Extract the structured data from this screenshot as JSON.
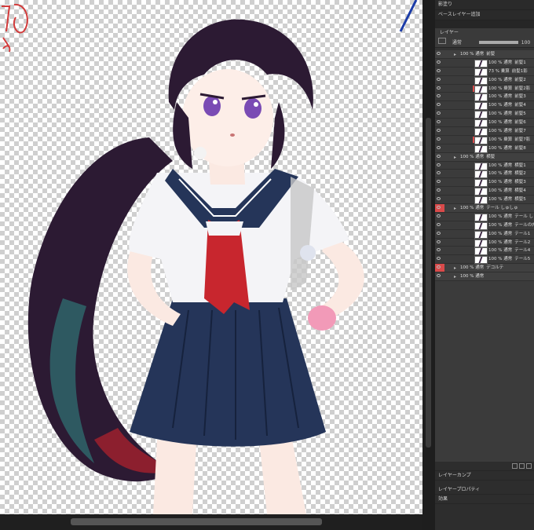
{
  "panel": {
    "top_label": "影塗り",
    "breadcrumb": "ベースレイヤー追加",
    "layer_tab": "レイヤー",
    "blend_mode": "通常",
    "opacity": "100",
    "bottom_tabs": [
      "レイヤーカンプ",
      "レイヤープロパティ"
    ],
    "effect_label": "効果",
    "layers": [
      {
        "kind": "folder",
        "indent": 1,
        "pct": "100 % 通常",
        "name": "前髪",
        "red": false
      },
      {
        "kind": "layer",
        "indent": 2,
        "pct": "100 % 通常",
        "name": "前髪1",
        "red": false
      },
      {
        "kind": "layer",
        "indent": 2,
        "pct": "73 % 乗算",
        "name": "前髪1影",
        "red": false
      },
      {
        "kind": "layer",
        "indent": 2,
        "pct": "100 % 通常",
        "name": "前髪2",
        "red": false
      },
      {
        "kind": "layer",
        "indent": 2,
        "pct": "100 % 乗算",
        "name": "前髪2影",
        "red": false,
        "sel": true
      },
      {
        "kind": "layer",
        "indent": 2,
        "pct": "100 % 通常",
        "name": "前髪3",
        "red": false
      },
      {
        "kind": "layer",
        "indent": 2,
        "pct": "100 % 通常",
        "name": "前髪4",
        "red": false
      },
      {
        "kind": "layer",
        "indent": 2,
        "pct": "100 % 通常",
        "name": "前髪5",
        "red": false
      },
      {
        "kind": "layer",
        "indent": 2,
        "pct": "100 % 通常",
        "name": "前髪6",
        "red": false
      },
      {
        "kind": "layer",
        "indent": 2,
        "pct": "100 % 通常",
        "name": "前髪7",
        "red": false
      },
      {
        "kind": "layer",
        "indent": 2,
        "pct": "100 % 乗算",
        "name": "前髪7影",
        "red": false,
        "sel": true
      },
      {
        "kind": "layer",
        "indent": 2,
        "pct": "100 % 通常",
        "name": "前髪8",
        "red": false
      },
      {
        "kind": "folder",
        "indent": 1,
        "pct": "100 % 通常",
        "name": "横髪",
        "red": false
      },
      {
        "kind": "layer",
        "indent": 2,
        "pct": "100 % 通常",
        "name": "横髪1",
        "red": false
      },
      {
        "kind": "layer",
        "indent": 2,
        "pct": "100 % 通常",
        "name": "横髪2",
        "red": false
      },
      {
        "kind": "layer",
        "indent": 2,
        "pct": "100 % 通常",
        "name": "横髪3",
        "red": false
      },
      {
        "kind": "layer",
        "indent": 2,
        "pct": "100 % 通常",
        "name": "横髪4",
        "red": false
      },
      {
        "kind": "layer",
        "indent": 2,
        "pct": "100 % 通常",
        "name": "横髪5",
        "red": false
      },
      {
        "kind": "folder",
        "indent": 1,
        "pct": "100 % 通常",
        "name": "テール しゅしゅ",
        "red": true
      },
      {
        "kind": "layer",
        "indent": 2,
        "pct": "100 % 通常",
        "name": "テール しゅしゅ",
        "red": false
      },
      {
        "kind": "layer",
        "indent": 2,
        "pct": "100 % 通常",
        "name": "テールの内側",
        "red": false
      },
      {
        "kind": "layer",
        "indent": 2,
        "pct": "100 % 通常",
        "name": "テール1",
        "red": false
      },
      {
        "kind": "layer",
        "indent": 2,
        "pct": "100 % 通常",
        "name": "テール2",
        "red": false
      },
      {
        "kind": "layer",
        "indent": 2,
        "pct": "100 % 通常",
        "name": "テール4",
        "red": false
      },
      {
        "kind": "layer",
        "indent": 2,
        "pct": "100 % 通常",
        "name": "テール5",
        "red": false
      },
      {
        "kind": "folder",
        "indent": 1,
        "pct": "100 % 通常",
        "name": "デコルテ",
        "red": true
      },
      {
        "kind": "folder",
        "indent": 1,
        "pct": "100 % 通常",
        "name": "",
        "red": false
      }
    ]
  }
}
